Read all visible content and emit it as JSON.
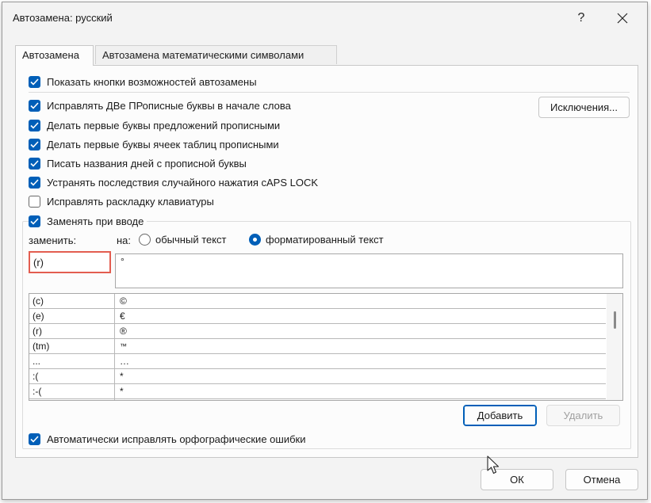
{
  "window": {
    "title": "Автозамена: русский",
    "help_label": "?",
    "close_label": "✕"
  },
  "tabs": [
    {
      "label": "Автозамена",
      "active": true
    },
    {
      "label": "Автозамена математическими символами",
      "active": false
    }
  ],
  "options": {
    "show_buttons": {
      "label": "Показать кнопки возможностей автозамены",
      "checked": true
    },
    "two_caps": {
      "label": "Исправлять ДВе ПРописные буквы в начале слова",
      "checked": true
    },
    "sentence_caps": {
      "label": "Делать первые буквы предложений прописными",
      "checked": true
    },
    "cell_caps": {
      "label": "Делать первые буквы ячеек таблиц прописными",
      "checked": true
    },
    "day_names": {
      "label": "Писать названия дней с прописной буквы",
      "checked": true
    },
    "caps_lock": {
      "label": "Устранять последствия случайного нажатия cAPS LOCK",
      "checked": true
    },
    "keyboard_layout": {
      "label": "Исправлять раскладку клавиатуры",
      "checked": false
    },
    "replace_typing": {
      "label": "Заменять при вводе",
      "checked": true
    },
    "spelling": {
      "label": "Автоматически исправлять орфографические ошибки",
      "checked": true
    }
  },
  "exceptions_button": "Исключения...",
  "replace": {
    "replace_label": "заменить:",
    "with_label": "на:",
    "radio_plain": {
      "label": "обычный текст",
      "selected": false
    },
    "radio_formatted": {
      "label": "форматированный текст",
      "selected": true
    },
    "replace_value": "(r)",
    "with_value": "°"
  },
  "list": [
    {
      "from": "(c)",
      "to": "©"
    },
    {
      "from": "(e)",
      "to": "€"
    },
    {
      "from": "(r)",
      "to": "®"
    },
    {
      "from": "(tm)",
      "to": "™"
    },
    {
      "from": "...",
      "to": "…"
    },
    {
      "from": ":(",
      "to": "*"
    },
    {
      "from": ":-(",
      "to": "*"
    }
  ],
  "buttons": {
    "add": "Добавить",
    "delete": "Удалить",
    "ok": "ОК",
    "cancel": "Отмена"
  },
  "colors": {
    "accent": "#005fb8",
    "highlight_border": "#e35d50"
  }
}
